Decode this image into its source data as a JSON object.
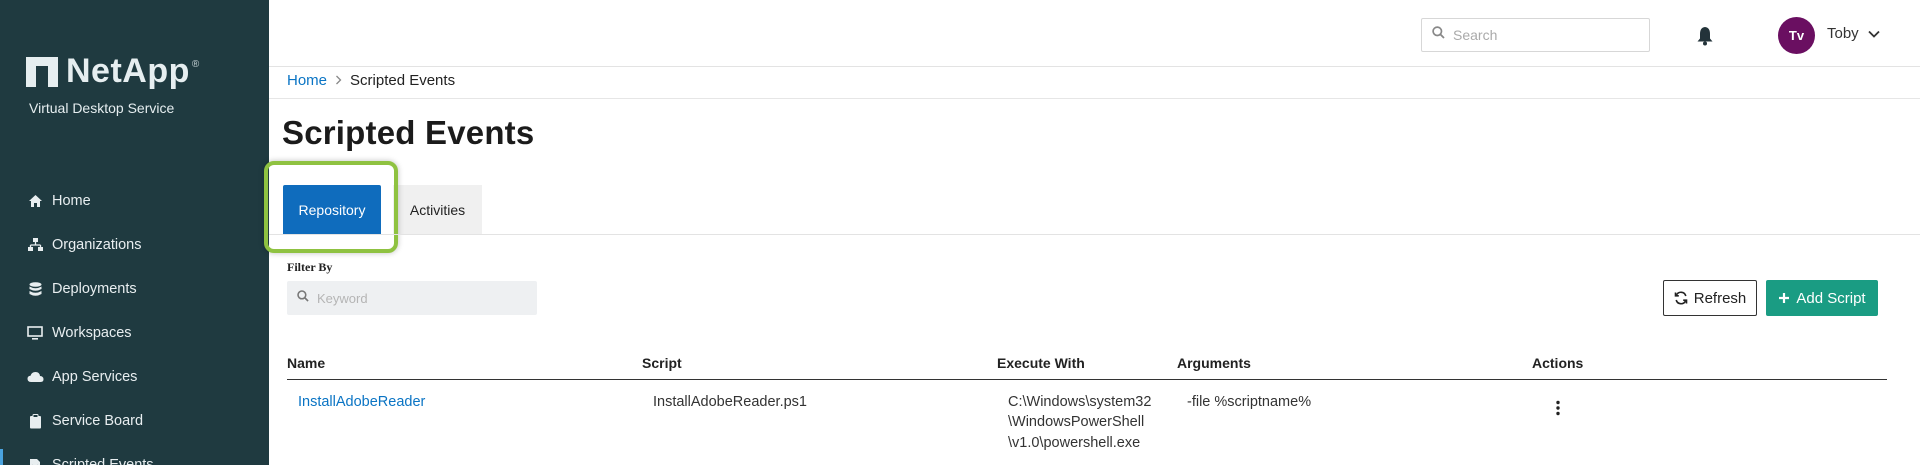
{
  "brand": {
    "name": "NetApp",
    "reg": "®",
    "subtitle": "Virtual Desktop Service"
  },
  "sidebar": {
    "items": [
      {
        "label": "Home",
        "icon": "home-icon"
      },
      {
        "label": "Organizations",
        "icon": "org-chart-icon"
      },
      {
        "label": "Deployments",
        "icon": "database-icon"
      },
      {
        "label": "Workspaces",
        "icon": "monitor-icon"
      },
      {
        "label": "App Services",
        "icon": "cloud-icon"
      },
      {
        "label": "Service Board",
        "icon": "clipboard-icon"
      },
      {
        "label": "Scripted Events",
        "icon": "file-code-icon"
      }
    ],
    "active": "Scripted Events"
  },
  "topbar": {
    "search_placeholder": "Search",
    "user": {
      "initials": "Tv",
      "name": "Toby"
    }
  },
  "breadcrumb": {
    "home": "Home",
    "current": "Scripted Events"
  },
  "page": {
    "title": "Scripted Events"
  },
  "tabs": [
    {
      "label": "Repository",
      "active": true
    },
    {
      "label": "Activities",
      "active": false
    }
  ],
  "filter": {
    "label": "Filter By",
    "placeholder": "Keyword"
  },
  "buttons": {
    "refresh": "Refresh",
    "add_script": "Add Script"
  },
  "table": {
    "columns": [
      "Name",
      "Script",
      "Execute With",
      "Arguments",
      "Actions"
    ],
    "rows": [
      {
        "name": "InstallAdobeReader",
        "script": "InstallAdobeReader.ps1",
        "execute_with": [
          "C:\\Windows\\system32",
          "\\WindowsPowerShell",
          "\\v1.0\\powershell.exe"
        ],
        "arguments": "-file %scriptname%"
      }
    ]
  },
  "colors": {
    "sidebar": "#1f3a40",
    "primary": "#0f6cbd",
    "add_button": "#1a9c83",
    "avatar": "#6a0f61",
    "highlight": "#8fc241"
  }
}
